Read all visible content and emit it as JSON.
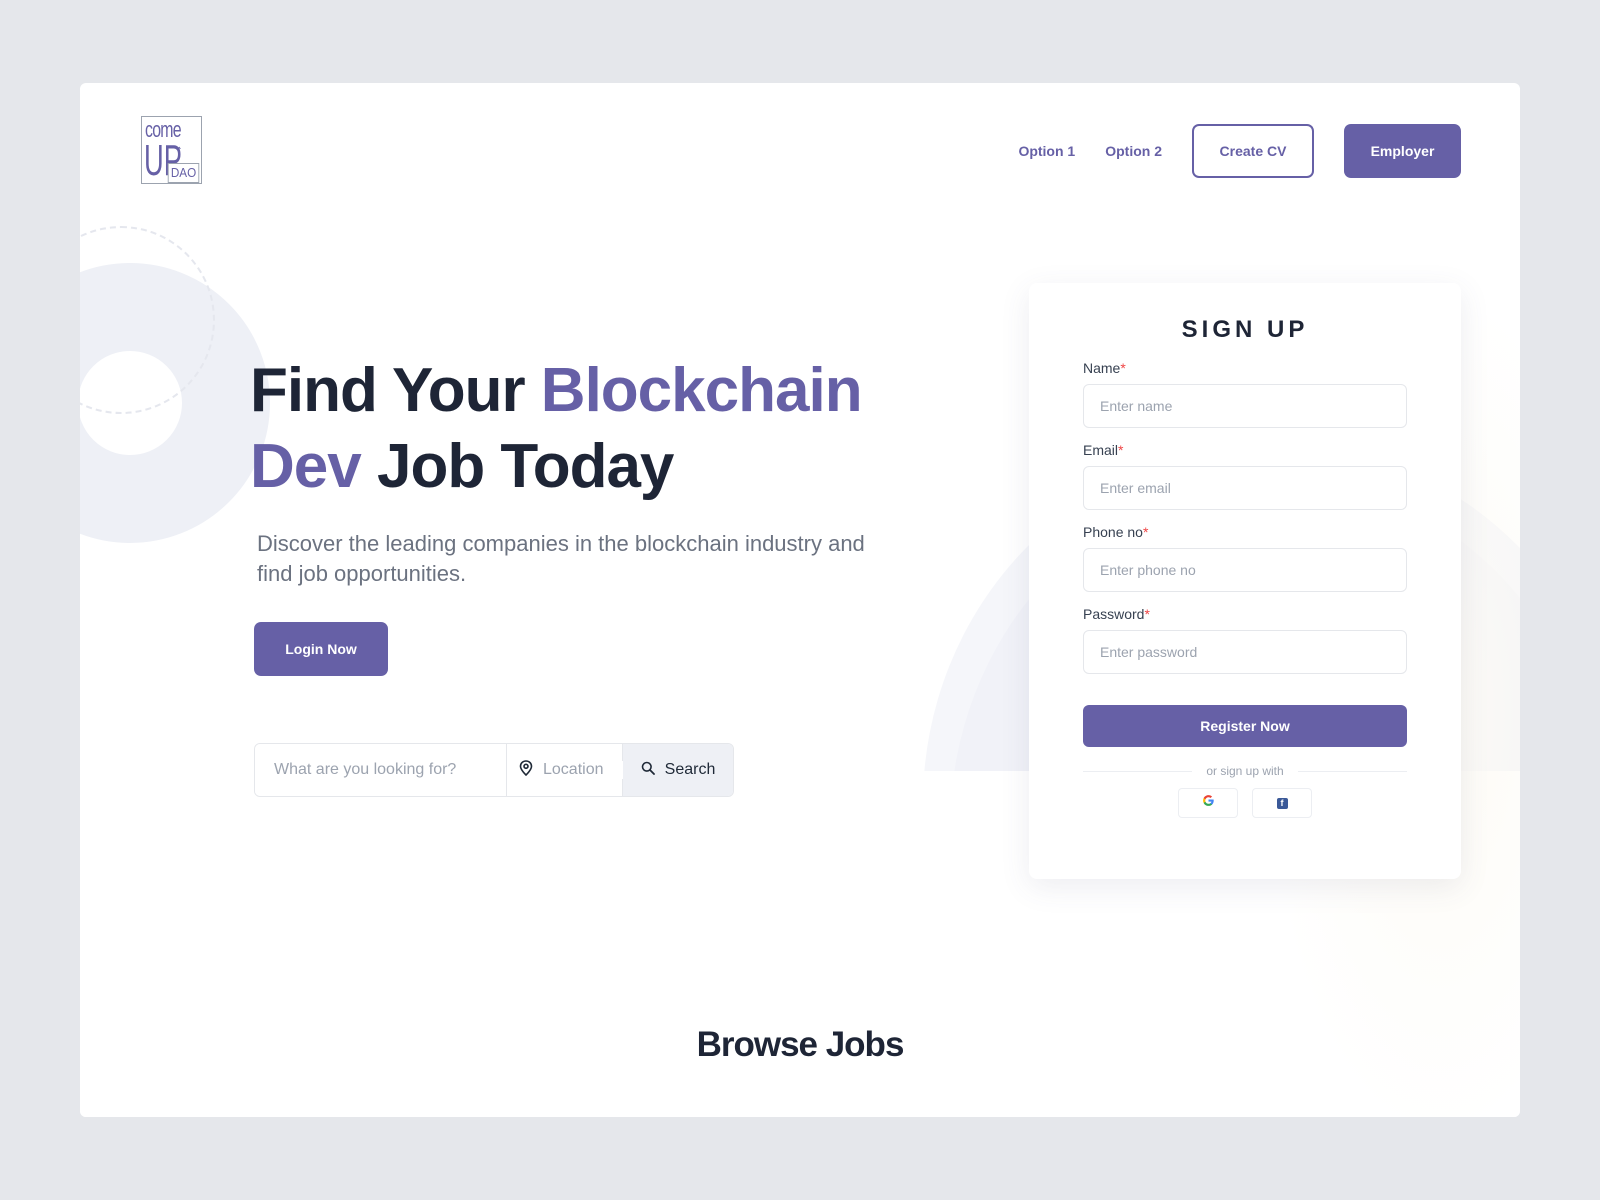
{
  "brand": {
    "logo_top": "come",
    "logo_main": "UP",
    "logo_sub": "DAO",
    "accent_color": "#6660a6"
  },
  "nav": {
    "option1": "Option 1",
    "option2": "Option 2",
    "create_cv": "Create CV",
    "employer": "Employer"
  },
  "hero": {
    "title_part1": "Find Your ",
    "title_accent1": "Blockchain",
    "title_accent2": "Dev",
    "title_part2": " Job Today",
    "subtitle": "Discover the leading companies in the blockchain industry and find job opportunities.",
    "login_label": "Login Now"
  },
  "search": {
    "query_placeholder": "What are you looking for?",
    "location_placeholder": "Location",
    "button_label": "Search"
  },
  "signup": {
    "title": "SIGN UP",
    "required_marker": "*",
    "fields": [
      {
        "label": "Name",
        "placeholder": "Enter name"
      },
      {
        "label": "Email",
        "placeholder": "Enter email"
      },
      {
        "label": "Phone no",
        "placeholder": "Enter phone no"
      },
      {
        "label": "Password",
        "placeholder": "Enter password"
      }
    ],
    "register_label": "Register Now",
    "or_text": "or sign up with",
    "social": [
      "google-icon",
      "facebook-icon"
    ]
  },
  "browse": {
    "title": "Browse Jobs"
  }
}
